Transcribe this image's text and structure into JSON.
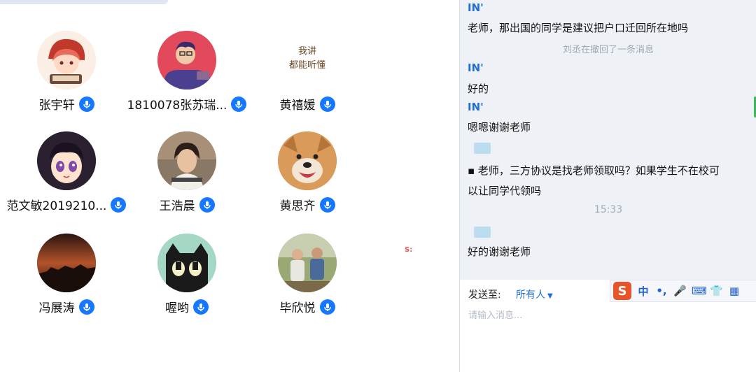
{
  "participants": [
    {
      "name": "张宇轩",
      "avatar": "anime-girl-avatar"
    },
    {
      "name": "1810078张苏瑞...",
      "avatar": "cartoon-man-avatar"
    },
    {
      "name": "黄禧媛",
      "avatar": "text-sticker-avatar"
    },
    {
      "name": "范文敏2019210...",
      "avatar": "anime-face-avatar"
    },
    {
      "name": "王浩晨",
      "avatar": "photo-person-avatar"
    },
    {
      "name": "黄思齐",
      "avatar": "dog-avatar"
    },
    {
      "name": "冯展涛",
      "avatar": "sunset-avatar"
    },
    {
      "name": "喔哟",
      "avatar": "black-cat-avatar"
    },
    {
      "name": "毕欣悦",
      "avatar": "group-photo-avatar"
    }
  ],
  "sticker_text": [
    "我讲",
    "都能听懂"
  ],
  "chat": {
    "messages": [
      {
        "sender": "IN'",
        "text": "老师，那出国的同学是建议把户口迁回所在地吗"
      },
      {
        "system": "刘丞在撤回了一条消息"
      },
      {
        "sender": "IN'",
        "text": "好的"
      },
      {
        "sender": "IN'",
        "text": "嗯嗯谢谢老师"
      },
      {
        "text_a": "▪ 老师，三方协议是找老师领取吗？如果学生不在校可",
        "text_b": "以让同学代领吗"
      },
      {
        "time": "15:33"
      },
      {
        "text": "好的谢谢老师"
      }
    ],
    "send_to_label": "发送至:",
    "send_to_value": "所有人",
    "input_placeholder": "请输入消息..."
  },
  "ime": {
    "logo": "S",
    "items": [
      "中",
      "•,",
      "🎤",
      "⌨",
      "👕",
      "▦"
    ]
  },
  "colors": {
    "accent": "#1f6fd6",
    "badge": "#1677ff",
    "chat_bg": "#eef2f7"
  }
}
